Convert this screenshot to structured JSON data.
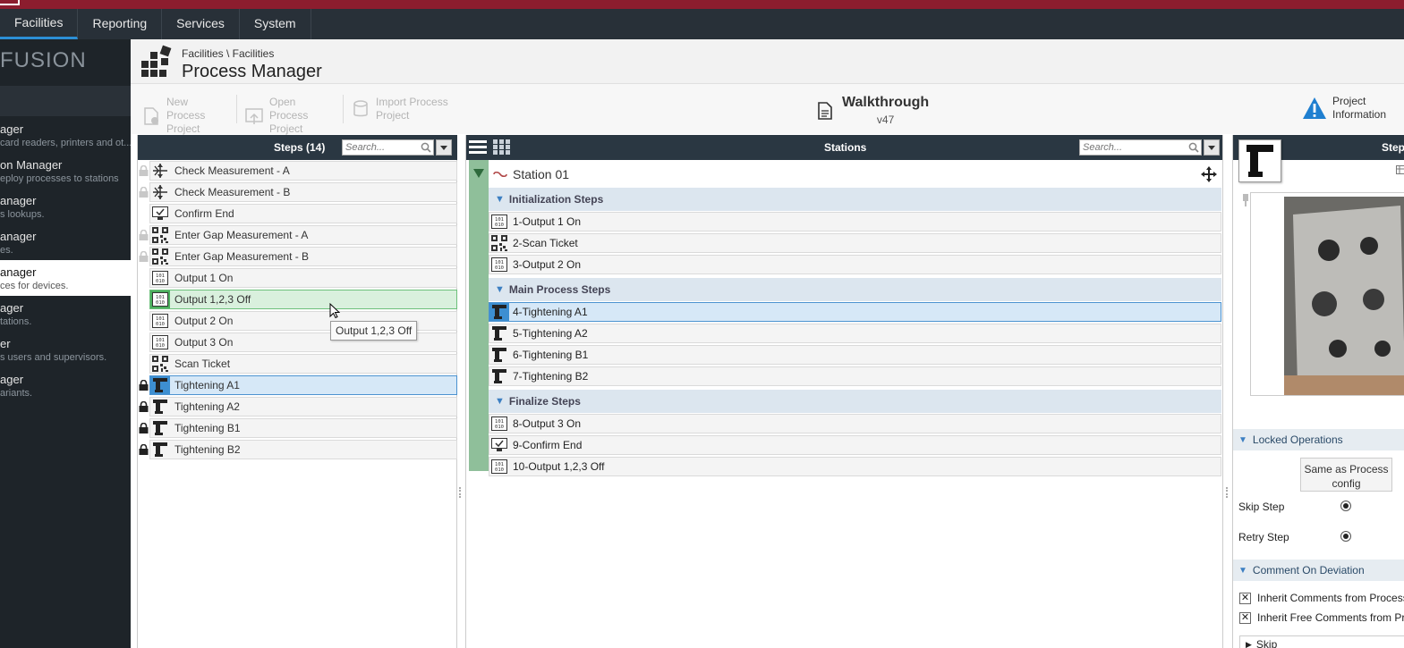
{
  "menu": {
    "items": [
      {
        "label": "Facilities",
        "active": true
      },
      {
        "label": "Reporting",
        "active": false
      },
      {
        "label": "Services",
        "active": false
      },
      {
        "label": "System",
        "active": false
      }
    ]
  },
  "brand": "FUSION",
  "nav": {
    "items": [
      {
        "title": "ager",
        "subtitle": "card readers, printers and ot..."
      },
      {
        "title": "on Manager",
        "subtitle": "eploy processes to stations"
      },
      {
        "title": "anager",
        "subtitle": "s lookups."
      },
      {
        "title": "anager",
        "subtitle": "es."
      },
      {
        "title": "anager",
        "subtitle": "ces for devices.",
        "active": true
      },
      {
        "title": "ager",
        "subtitle": "tations."
      },
      {
        "title": "er",
        "subtitle": "s users and supervisors."
      },
      {
        "title": "ager",
        "subtitle": "ariants."
      }
    ]
  },
  "header": {
    "breadcrumb": "Facilities \\ Facilities",
    "title": "Process Manager"
  },
  "toolbar": {
    "new_process": "New Process Project",
    "open_process": "Open Process Project",
    "import_process": "Import Process Project",
    "project_name": "Walkthrough",
    "project_version": "v47",
    "project_info": "Project Information"
  },
  "steps": {
    "title": "Steps (14)",
    "search_placeholder": "Search...",
    "hover_index": 6,
    "selected_index": 10,
    "tooltip": "Output 1,2,3 Off",
    "items": [
      {
        "label": "Check Measurement - A",
        "icon": "measure",
        "lock": "light"
      },
      {
        "label": "Check Measurement - B",
        "icon": "measure",
        "lock": "light"
      },
      {
        "label": "Confirm End",
        "icon": "confirm",
        "lock": "none"
      },
      {
        "label": "Enter Gap Measurement - A",
        "icon": "qr",
        "lock": "light"
      },
      {
        "label": "Enter Gap Measurement - B",
        "icon": "qr",
        "lock": "light"
      },
      {
        "label": "Output 1 On",
        "icon": "io",
        "lock": "none"
      },
      {
        "label": "Output 1,2,3 Off",
        "icon": "io",
        "lock": "none"
      },
      {
        "label": "Output 2 On",
        "icon": "io",
        "lock": "none"
      },
      {
        "label": "Output 3 On",
        "icon": "io",
        "lock": "none"
      },
      {
        "label": "Scan Ticket",
        "icon": "qr",
        "lock": "none"
      },
      {
        "label": "Tightening A1",
        "icon": "tool",
        "lock": "dark"
      },
      {
        "label": "Tightening A2",
        "icon": "tool",
        "lock": "dark"
      },
      {
        "label": "Tightening B1",
        "icon": "tool",
        "lock": "dark"
      },
      {
        "label": "Tightening B2",
        "icon": "tool",
        "lock": "dark"
      }
    ]
  },
  "stations": {
    "title": "Stations",
    "search_placeholder": "Search...",
    "station_name": "Station 01",
    "groups": [
      {
        "label": "Initialization Steps",
        "steps": [
          {
            "label": "1-Output 1 On",
            "icon": "io"
          },
          {
            "label": "2-Scan Ticket",
            "icon": "qr"
          },
          {
            "label": "3-Output 2 On",
            "icon": "io"
          }
        ]
      },
      {
        "label": "Main Process Steps",
        "steps": [
          {
            "label": "4-Tightening A1",
            "icon": "tool",
            "selected": true
          },
          {
            "label": "5-Tightening A2",
            "icon": "tool"
          },
          {
            "label": "6-Tightening B1",
            "icon": "tool"
          },
          {
            "label": "7-Tightening B2",
            "icon": "tool"
          }
        ]
      },
      {
        "label": "Finalize Steps",
        "steps": [
          {
            "label": "8-Output 3 On",
            "icon": "io"
          },
          {
            "label": "9-Confirm End",
            "icon": "confirm"
          },
          {
            "label": "10-Output 1,2,3 Off",
            "icon": "io"
          }
        ]
      }
    ]
  },
  "details": {
    "title": "Step",
    "locked_ops": {
      "title": "Locked Operations",
      "column": "Same as Process config",
      "rows": [
        "Skip Step",
        "Retry Step"
      ]
    },
    "comment": {
      "title": "Comment On Deviation",
      "options": [
        "Inherit Comments from Process",
        "Inherit Free Comments from Process"
      ],
      "skip_label": "Skip"
    }
  },
  "colors": {
    "brand_bar": "#8c1d2e",
    "menu_bg": "#283038",
    "accent": "#2c8fd6",
    "panel_header": "#2a3742",
    "selection": "#d6e8f7",
    "hover": "#d9f0dd"
  }
}
